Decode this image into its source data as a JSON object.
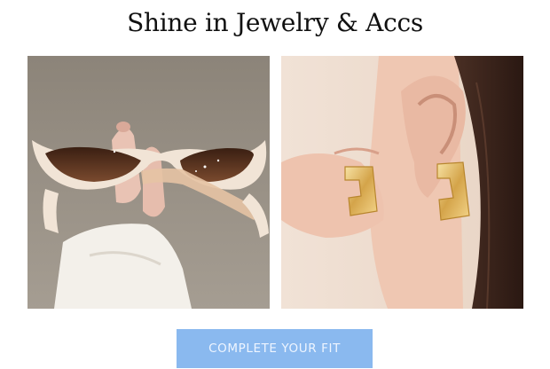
{
  "heading": {
    "title": "Shine in Jewelry & Accs"
  },
  "products": [
    {
      "name": "sunglasses-photo"
    },
    {
      "name": "earrings-photo"
    }
  ],
  "cta": {
    "label": "COMPLETE YOUR FIT"
  },
  "colors": {
    "cta_background": "#8ab9ef",
    "cta_text": "#eef5ff",
    "title_text": "#111111"
  }
}
